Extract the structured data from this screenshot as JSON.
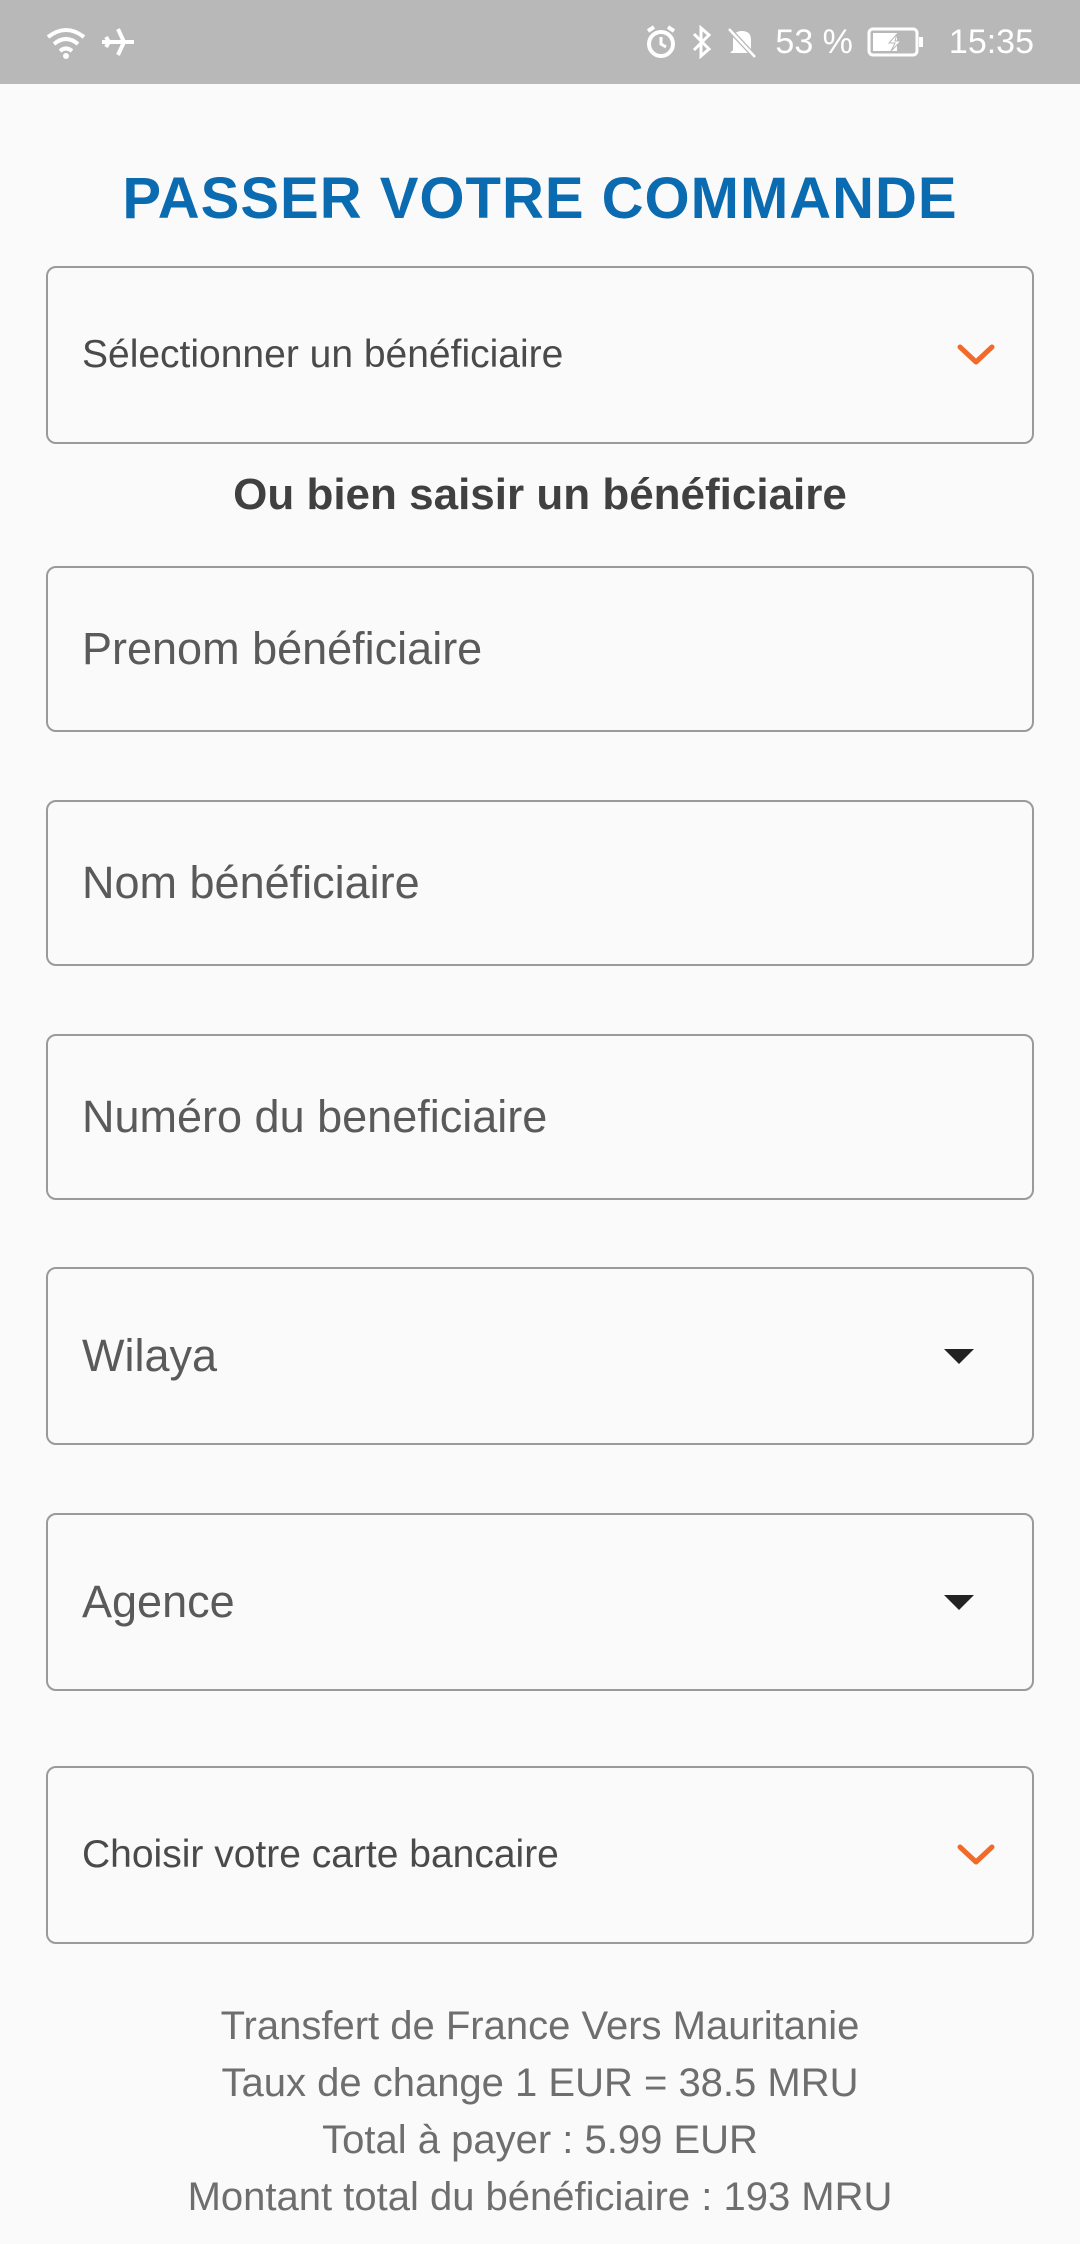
{
  "status_bar": {
    "battery_percent": "53 %",
    "time": "15:35",
    "icons": [
      "wifi-icon",
      "airplane-icon",
      "alarm-icon",
      "bluetooth-icon",
      "bell-off-icon",
      "battery-charging-icon"
    ]
  },
  "title": "PASSER VOTRE COMMANDE",
  "beneficiary_select": {
    "placeholder": "Sélectionner un bénéficiaire"
  },
  "alt_text": "Ou bien saisir un bénéficiaire",
  "fields": {
    "prenom_placeholder": "Prenom bénéficiaire",
    "nom_placeholder": "Nom bénéficiaire",
    "numero_placeholder": "Numéro du beneficiaire",
    "wilaya_placeholder": "Wilaya",
    "agence_placeholder": "Agence",
    "carte_placeholder": "Choisir votre carte bancaire"
  },
  "info": {
    "line1": "Transfert de France Vers Mauritanie",
    "line2": "Taux de change 1  EUR = 38.5 MRU",
    "line3": "Total à payer : 5.99 EUR",
    "line4": "Montant total du bénéficiaire :  193 MRU"
  },
  "colors": {
    "title": "#0a6bb0",
    "chevron_accent": "#f26a2a",
    "status_bar_bg": "#b8b8b8"
  }
}
